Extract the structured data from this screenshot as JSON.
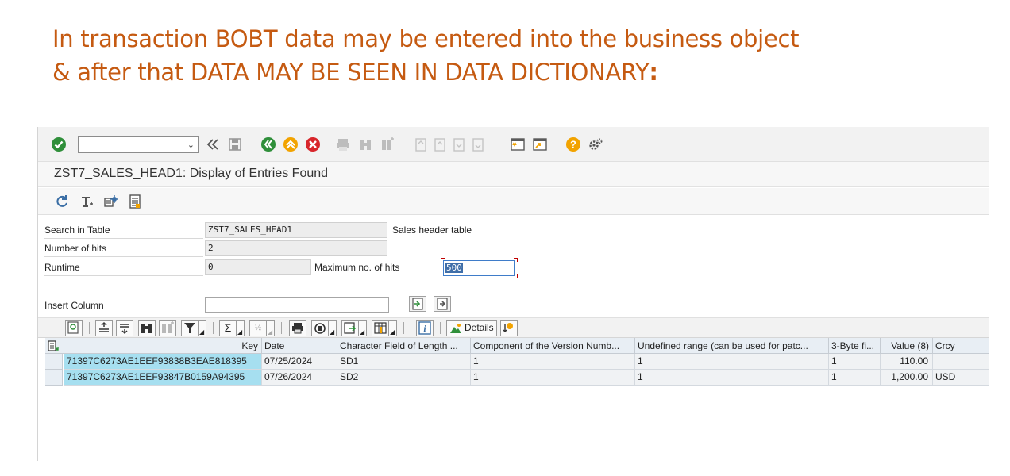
{
  "slide": {
    "title_line1": "In transaction BOBT data may be entered into the business object",
    "title_line2_prefix": "& after that DATA MAY BE SEEN IN DATA DICTIONARY",
    "title_line2_suffix": ":"
  },
  "window": {
    "title": "ZST7_SALES_HEAD1: Display of Entries Found",
    "command_field_value": ""
  },
  "form": {
    "search_label": "Search in Table",
    "search_value": "ZST7_SALES_HEAD1",
    "search_desc": "Sales header table",
    "hits_label": "Number of hits",
    "hits_value": "2",
    "runtime_label": "Runtime",
    "runtime_value": "0",
    "maxhits_label": "Maximum no. of hits",
    "maxhits_value": "500",
    "insert_label": "Insert Column",
    "insert_value": ""
  },
  "alv": {
    "details_label": "Details"
  },
  "table": {
    "columns": [
      "Key",
      "Date",
      "Character Field of Length ...",
      "Component of the Version Numb...",
      "Undefined range (can be used for patc...",
      "3-Byte fi...",
      "Value (8)",
      "Crcy"
    ],
    "rows": [
      [
        "71397C6273AE1EEF93838B3EAE818395",
        "07/25/2024",
        "SD1",
        "1",
        "1",
        "1",
        "110.00",
        ""
      ],
      [
        "71397C6273AE1EEF93847B0159A94395",
        "07/26/2024",
        "SD2",
        "1",
        "1",
        "1",
        "1,200.00",
        "USD"
      ]
    ]
  },
  "colors": {
    "title": "#c55a11",
    "key_cell": "#a6dff0",
    "header_bg": "#e8eef4"
  }
}
